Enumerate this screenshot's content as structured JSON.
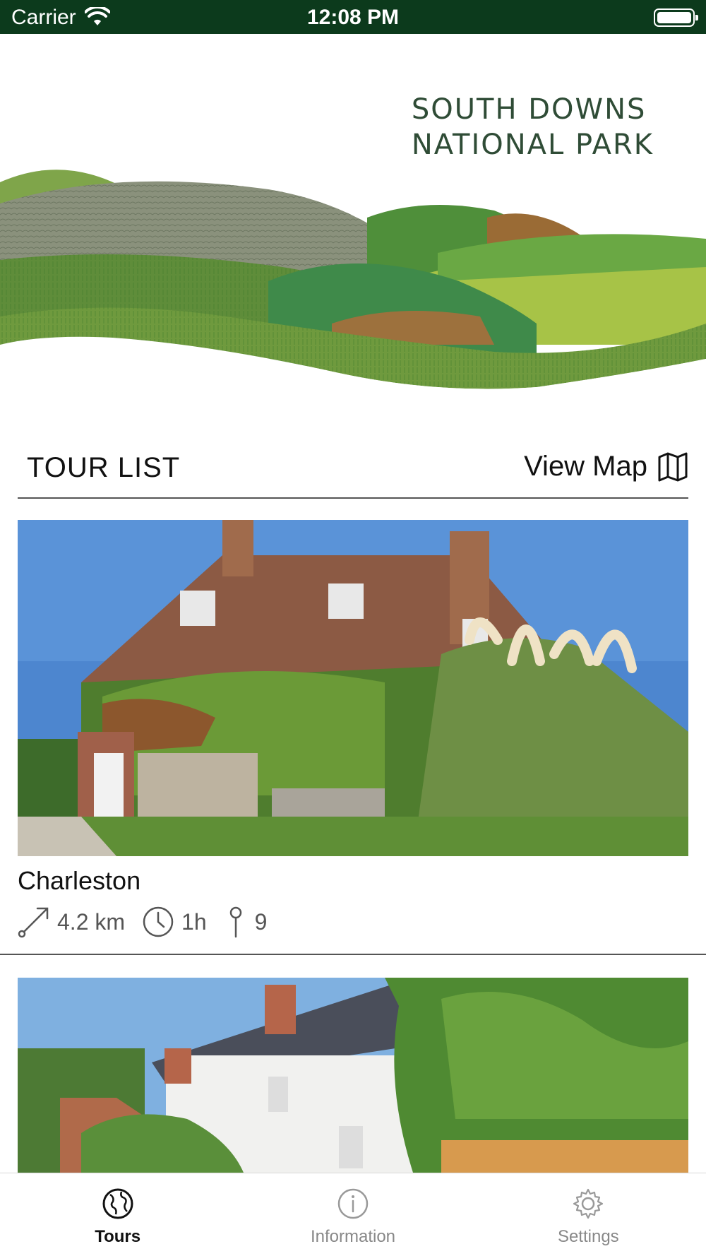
{
  "status_bar": {
    "carrier": "Carrier",
    "time": "12:08 PM"
  },
  "header": {
    "brand_line1": "SOUTH DOWNS",
    "brand_line2": "NATIONAL PARK",
    "brand_color": "#2f4c36"
  },
  "tour_list": {
    "title": "TOUR LIST",
    "view_map_label": "View Map",
    "tours": [
      {
        "name": "Charleston",
        "distance": "4.2 km",
        "duration": "1h",
        "stops": "9"
      }
    ]
  },
  "tab_bar": {
    "items": [
      {
        "label": "Tours",
        "icon": "globe-icon",
        "active": true
      },
      {
        "label": "Information",
        "icon": "info-icon",
        "active": false
      },
      {
        "label": "Settings",
        "icon": "gear-icon",
        "active": false
      }
    ]
  },
  "colors": {
    "status_bar_bg": "#0c3a1c",
    "accent_dark_green": "#2f4c36"
  }
}
